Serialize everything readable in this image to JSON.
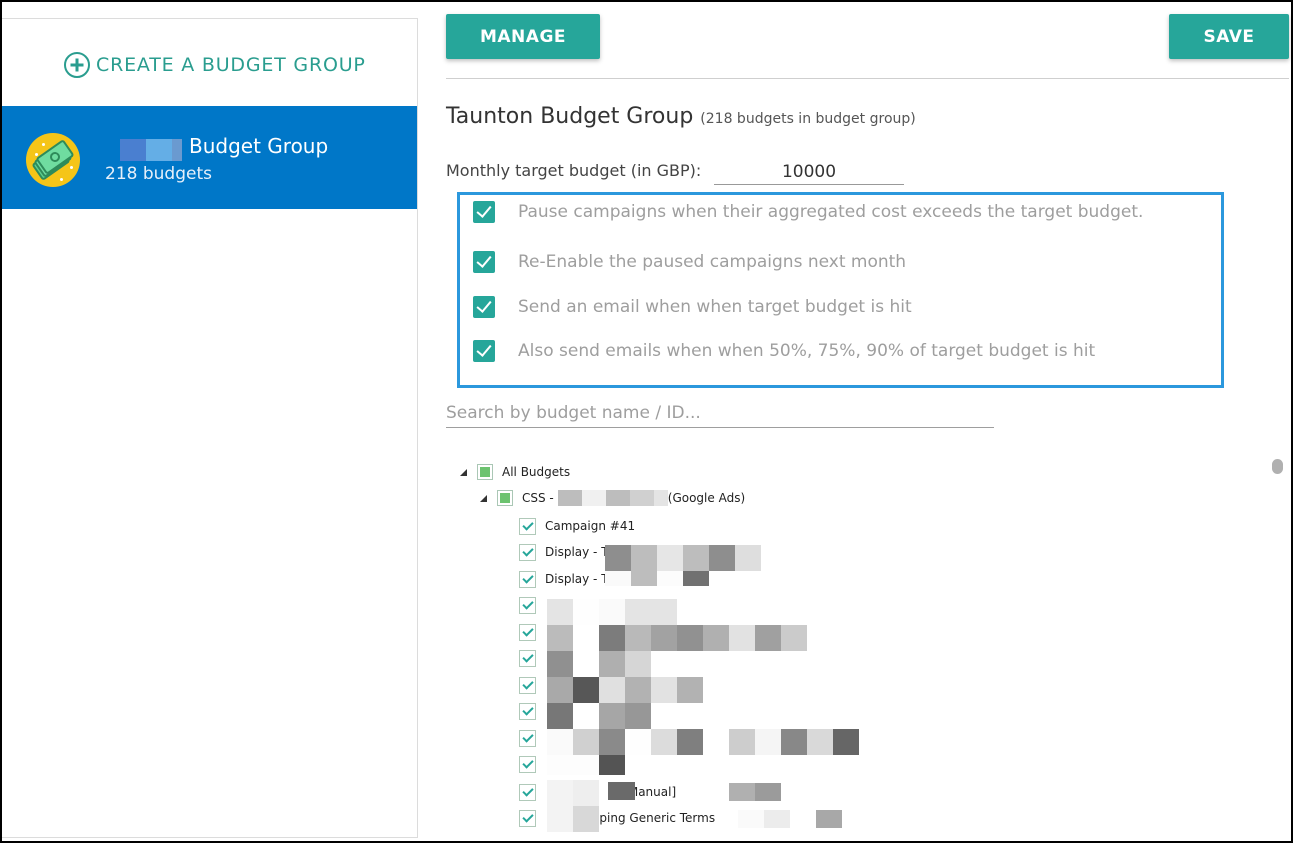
{
  "sidebar": {
    "create_label": "CREATE A BUDGET GROUP",
    "create_icon": "plus-circle-icon",
    "groups": [
      {
        "name": "Budget Group",
        "name_redacted_prefix": true,
        "count": "218 budgets",
        "avatar_icon": "money-bills-icon",
        "selected": true
      }
    ]
  },
  "toolbar": {
    "manage_label": "MANAGE",
    "save_label": "SAVE"
  },
  "group_detail": {
    "title": "Taunton Budget Group",
    "subtitle": "(218 budgets in budget group)",
    "target_label": "Monthly target budget (in GBP):",
    "target_value": "10000",
    "options": [
      {
        "label": "Pause campaigns when their aggregated cost exceeds the target budget.",
        "checked": true
      },
      {
        "label": "Re-Enable the paused campaigns next month",
        "checked": true
      },
      {
        "label": "Send an email when when target budget is hit",
        "checked": true
      },
      {
        "label": "Also send emails when when 50%, 75%, 90% of target budget is hit",
        "checked": true
      }
    ],
    "search_placeholder": "Search by budget name / ID..."
  },
  "tree": {
    "root": {
      "label": "All Budgets",
      "state": "partial",
      "expanded": true
    },
    "account": {
      "label_prefix": "CSS -",
      "label_suffix": "(Google Ads)",
      "state": "partial",
      "expanded": true
    },
    "items": [
      {
        "label": "Campaign #41",
        "checked": true
      },
      {
        "label": "Display - T",
        "checked": true,
        "redacted": true
      },
      {
        "label": "Display - T",
        "checked": true,
        "redacted": true
      },
      {
        "label": "",
        "checked": true,
        "redacted": true
      },
      {
        "label": "",
        "checked": true,
        "redacted": true
      },
      {
        "label": "",
        "checked": true,
        "redacted": true
      },
      {
        "label": "",
        "checked": true,
        "redacted": true
      },
      {
        "label": "",
        "checked": true,
        "redacted": true
      },
      {
        "label": "",
        "checked": true,
        "redacted": true
      },
      {
        "label": "",
        "checked": true,
        "redacted": true
      },
      {
        "label": "rg [Manual]",
        "checked": true,
        "redacted": true
      },
      {
        "label": "Camping Generic Terms",
        "checked": true,
        "redacted": true
      }
    ]
  },
  "colors": {
    "accent_teal": "#26a69a",
    "selected_blue": "#0077c8",
    "options_border": "#2b98dd",
    "muted_text": "#9e9e9e"
  }
}
